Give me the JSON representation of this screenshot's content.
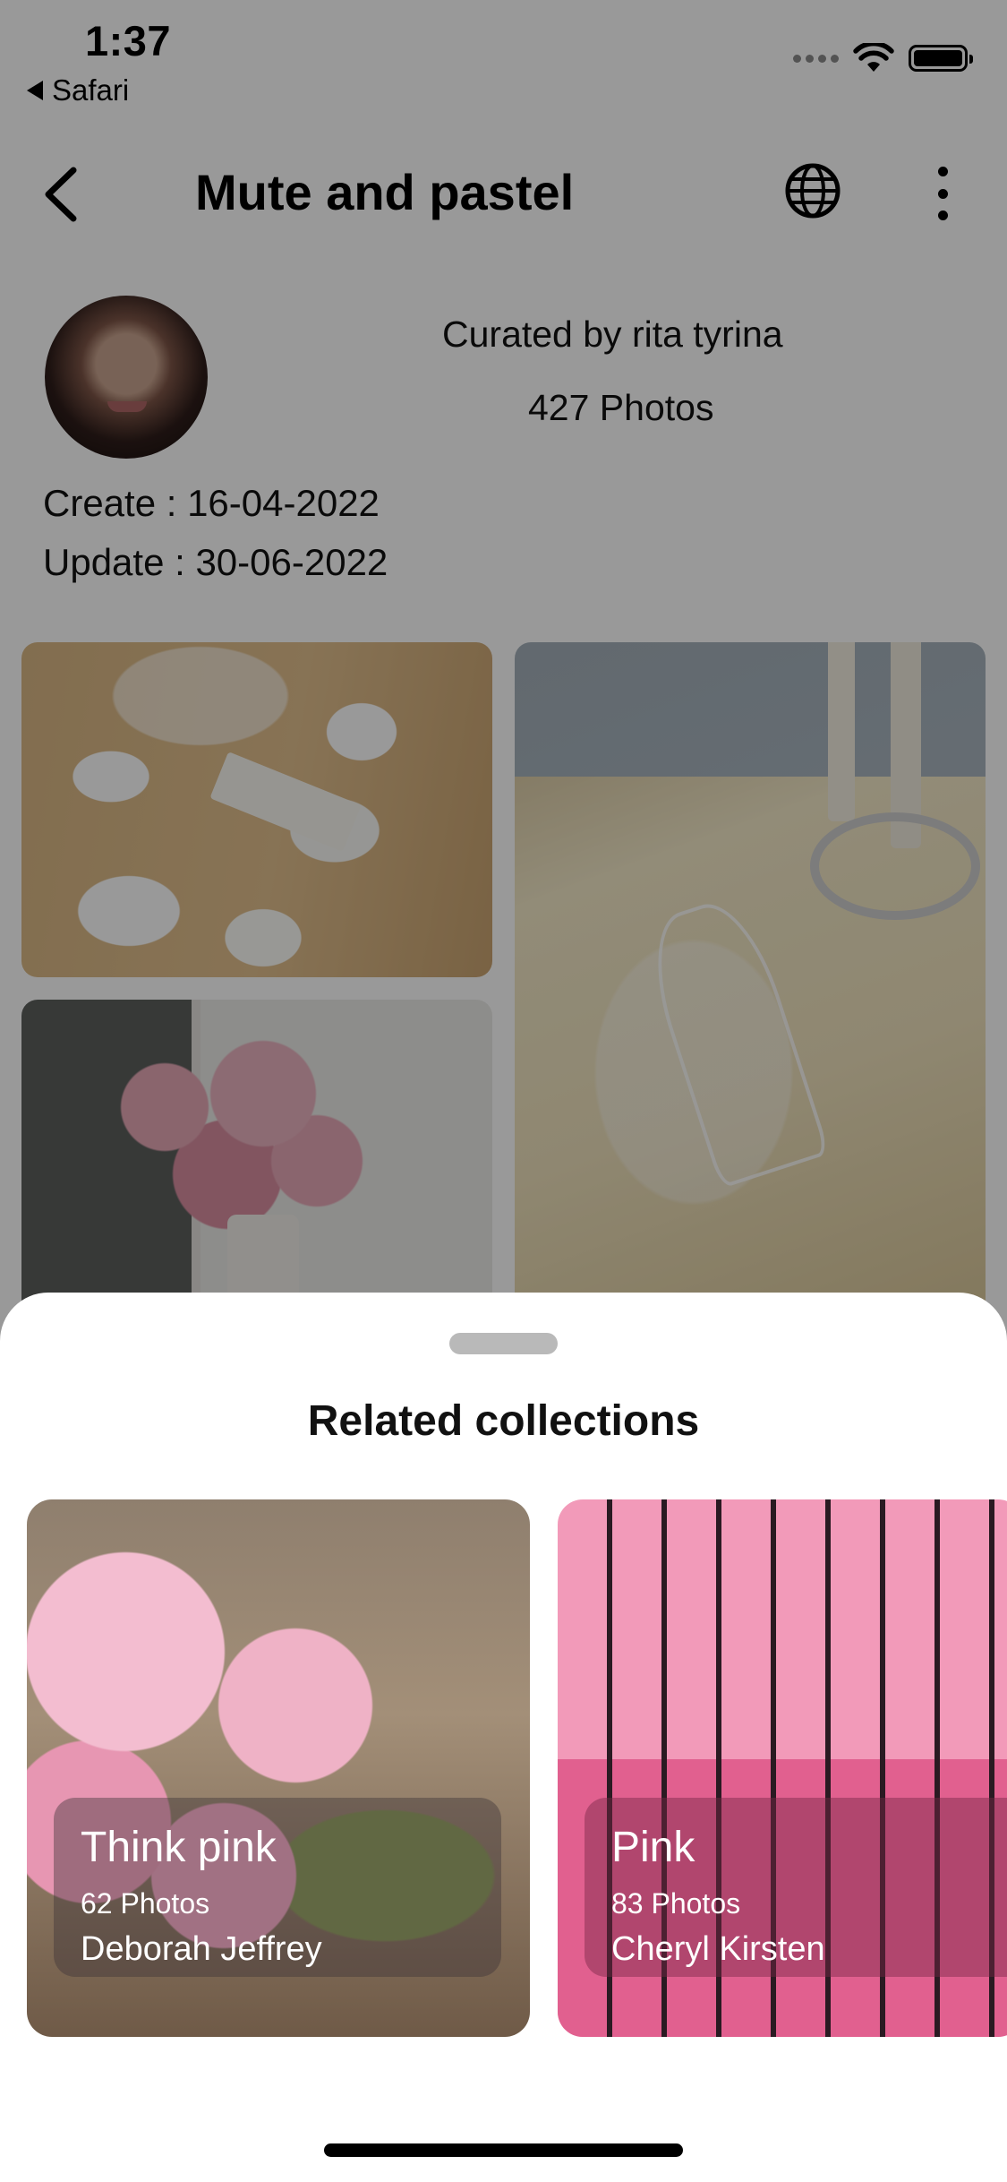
{
  "status_bar": {
    "time": "1:37",
    "back_app": "Safari",
    "icons": [
      "cellular-icon",
      "wifi-icon",
      "battery-icon"
    ]
  },
  "header": {
    "title": "Mute and pastel",
    "icons": [
      "back-chevron-icon",
      "globe-icon",
      "more-vertical-icon"
    ]
  },
  "collection": {
    "curated_by": "Curated by rita tyrina",
    "photos": "427 Photos",
    "create": "Create : 16-04-2022",
    "update": "Update : 30-06-2022"
  },
  "sheet": {
    "title": "Related collections",
    "cards": [
      {
        "name": "Think pink",
        "count": "62 Photos",
        "author": "Deborah Jeffrey"
      },
      {
        "name": "Pink",
        "count": "83 Photos",
        "author": "Cheryl Kirsten"
      }
    ]
  },
  "colors": {
    "overlay": "#000000",
    "sheet_bg": "#ffffff",
    "handle": "#b9b9b9"
  }
}
